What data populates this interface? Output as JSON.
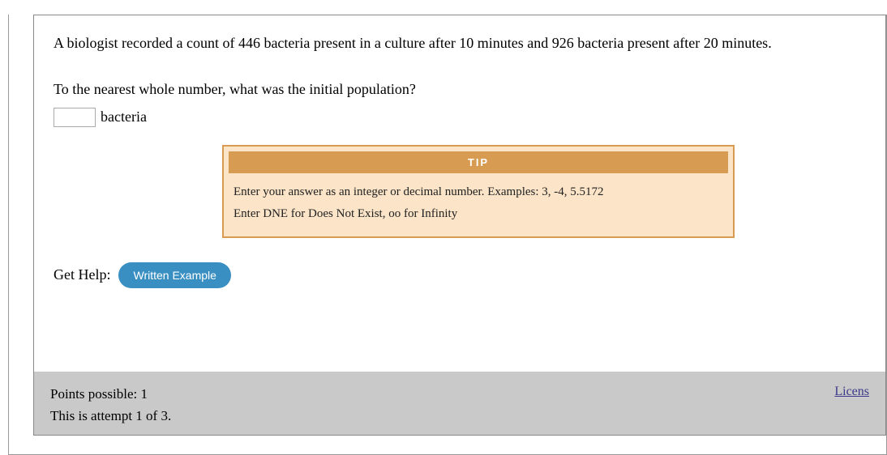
{
  "header": {
    "due_text_partial": ""
  },
  "question": {
    "problem": "A biologist recorded a count of 446 bacteria present in a culture after 10 minutes and 926 bacteria present after 20 minutes.",
    "prompt": "To the nearest whole number, what was the initial population?",
    "answer_value": "",
    "answer_unit": "bacteria"
  },
  "tip": {
    "header": "TIP",
    "line1": "Enter your answer as an integer or decimal number. Examples: 3, -4, 5.5172",
    "line2": "Enter DNE for Does Not Exist, oo for Infinity"
  },
  "help": {
    "label": "Get Help:",
    "button": "Written Example"
  },
  "footer": {
    "points": "Points possible: 1",
    "attempt": "This is attempt 1 of 3.",
    "license": "Licens"
  }
}
